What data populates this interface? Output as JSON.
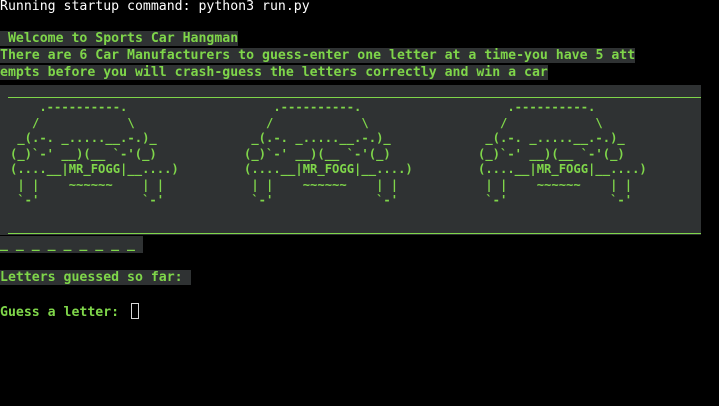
{
  "terminal": {
    "startup_line": "Running startup command: python3 run.py",
    "welcome": " Welcome to Sports Car Hangman",
    "intro_line1": "There are 6 Car Manufacturers to guess-enter one letter at a time-you have 5 att",
    "intro_line2": "empts before you will crash-guess the letters correctly and win a car",
    "car_art": "    .----------.\n   /            \\\n _(.-. _.....__.-.)_\n(_)`-' __)(__ `-'(_)\n(....__|MR_FOGG|__....)\n | |    ~~~~~~    | |\n `-'              `-'",
    "word_blanks": "_ _ _ _ _ _ _ _ _",
    "letters_guessed_label": "Letters guessed so far: ",
    "guess_prompt": "Guess a letter: "
  },
  "colors": {
    "text_green": "#7fd64a",
    "highlight_bg": "#2f3233",
    "background": "#000000"
  }
}
